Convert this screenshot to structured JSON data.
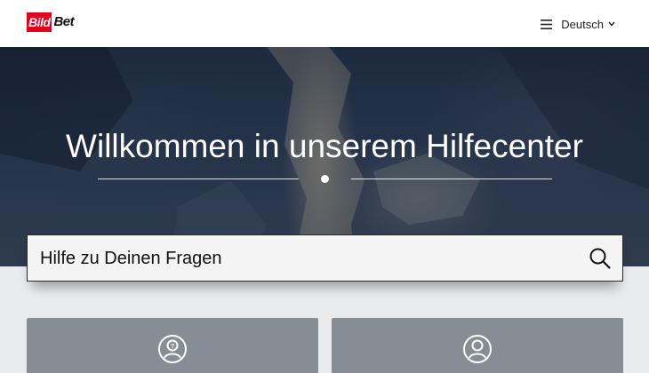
{
  "header": {
    "logo": {
      "part1": "Bild",
      "part2": "Bet"
    },
    "language": {
      "label": "Deutsch",
      "icon": "chevron-down-icon",
      "menu_icon": "hamburger-menu-icon"
    }
  },
  "hero": {
    "title": "Willkommen in unserem Hilfecenter"
  },
  "search": {
    "placeholder": "Hilfe zu Deinen Fragen",
    "icon": "search-icon"
  },
  "cards": [
    {
      "icon": "user-question-icon"
    },
    {
      "icon": "user-icon"
    }
  ],
  "colors": {
    "brand_red": "#e2001a",
    "card_bg": "#878d94",
    "page_bg": "#e9ecef"
  }
}
